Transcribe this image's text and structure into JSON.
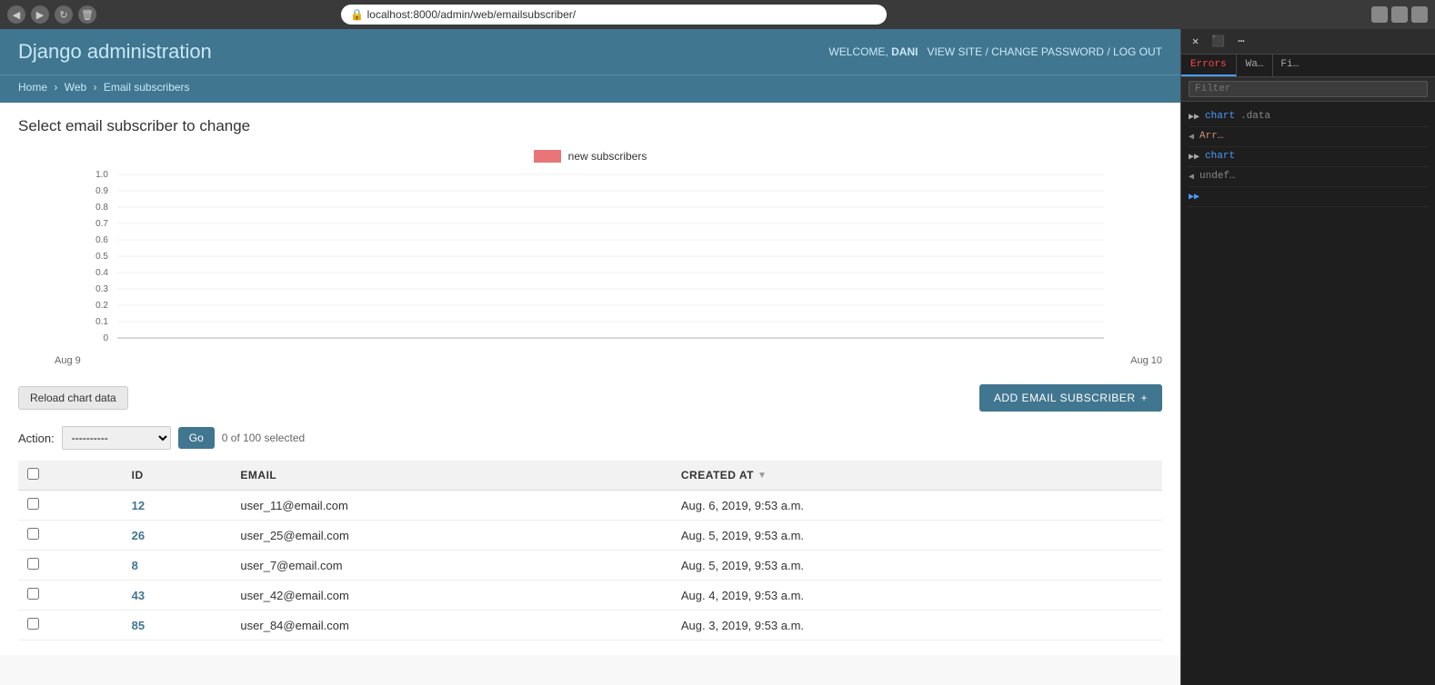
{
  "browser": {
    "url": "localhost:8000/admin/web/emailsubscriber/",
    "back_label": "◀",
    "forward_label": "▶",
    "reload_label": "↻"
  },
  "header": {
    "title_first": "Django",
    "title_second": "administration",
    "welcome_text": "WELCOME,",
    "username": "DANI",
    "view_site_label": "VIEW SITE",
    "change_password_label": "CHANGE PASSWORD",
    "log_out_label": "LOG OUT",
    "separator": "/"
  },
  "breadcrumb": {
    "home_label": "Home",
    "web_label": "Web",
    "current_label": "Email subscribers"
  },
  "page": {
    "title": "Select email subscriber to change"
  },
  "chart": {
    "legend_label": "new subscribers",
    "legend_color": "#e87679",
    "y_labels": [
      "1.0",
      "0.9",
      "0.8",
      "0.7",
      "0.6",
      "0.5",
      "0.4",
      "0.3",
      "0.2",
      "0.1",
      "0"
    ],
    "x_label_start": "Aug 9",
    "x_label_end": "Aug 10"
  },
  "actions": {
    "reload_button_label": "Reload chart data",
    "add_button_label": "ADD EMAIL SUBSCRIBER",
    "add_button_icon": "+"
  },
  "action_row": {
    "action_label": "Action:",
    "action_placeholder": "----------",
    "go_button_label": "Go",
    "selected_text": "0 of 100 selected"
  },
  "table": {
    "columns": [
      {
        "key": "id",
        "label": "ID",
        "sortable": false
      },
      {
        "key": "email",
        "label": "EMAIL",
        "sortable": false
      },
      {
        "key": "created_at",
        "label": "CREATED AT",
        "sortable": true
      }
    ],
    "rows": [
      {
        "id": "12",
        "email": "user_11@email.com",
        "created_at": "Aug. 6, 2019, 9:53 a.m."
      },
      {
        "id": "26",
        "email": "user_25@email.com",
        "created_at": "Aug. 5, 2019, 9:53 a.m."
      },
      {
        "id": "8",
        "email": "user_7@email.com",
        "created_at": "Aug. 5, 2019, 9:53 a.m."
      },
      {
        "id": "43",
        "email": "user_42@email.com",
        "created_at": "Aug. 4, 2019, 9:53 a.m."
      },
      {
        "id": "85",
        "email": "user_84@email.com",
        "created_at": "Aug. 3, 2019, 9:53 a.m."
      }
    ]
  },
  "devtools": {
    "tabs": [
      {
        "label": "Errors",
        "active": true,
        "class": "errors"
      },
      {
        "label": "Wa…",
        "active": false,
        "class": ""
      }
    ],
    "console_lines": [
      {
        "arrow": "▶▶",
        "arrow_dir": "right",
        "text": "chart",
        "text_class": "blue",
        "suffix": ".data",
        "suffix_class": "gray"
      },
      {
        "arrow": "◀",
        "arrow_dir": "left",
        "text": "Arr…",
        "text_class": "orange",
        "suffix": "",
        "suffix_class": ""
      },
      {
        "arrow": "▶▶",
        "arrow_dir": "right",
        "text": "chart",
        "text_class": "blue",
        "suffix": "",
        "suffix_class": ""
      },
      {
        "arrow": "◀",
        "arrow_dir": "left",
        "text": "undef…",
        "text_class": "gray",
        "suffix": "",
        "suffix_class": ""
      }
    ],
    "expand_icon": "▶▶"
  }
}
